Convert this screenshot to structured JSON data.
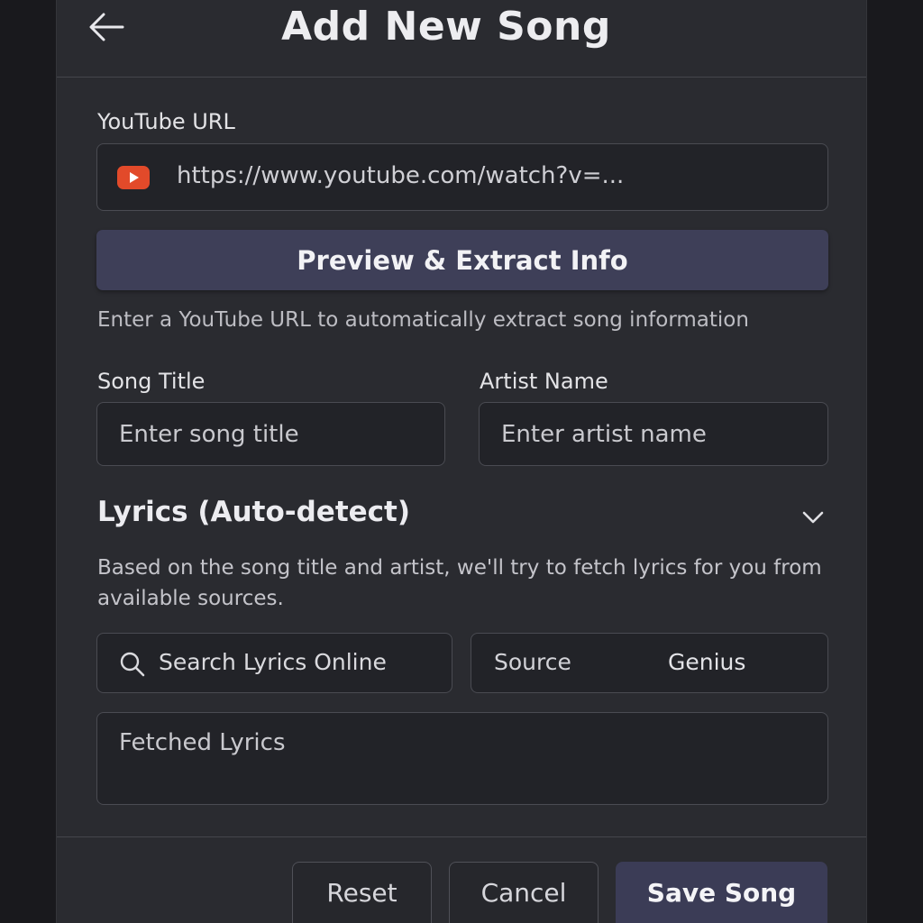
{
  "header": {
    "title": "Add New Song",
    "back_icon": "arrow-left-icon"
  },
  "youtube": {
    "label": "YouTube URL",
    "icon": "youtube-icon",
    "url_value": "https://www.youtube.com/watch?v=...",
    "extract_button_label": "Preview & Extract Info",
    "hint": "Enter a YouTube URL to automatically extract song information"
  },
  "song_title": {
    "label": "Song Title",
    "placeholder": "Enter song title"
  },
  "artist_name": {
    "label": "Artist Name",
    "placeholder": "Enter artist name"
  },
  "lyrics": {
    "section_title": "Lyrics (Auto-detect)",
    "toggle_icon": "chevron-down-icon",
    "description": "Based on the song title and artist, we'll try to fetch lyrics for you from available sources.",
    "search_button_label": "Search Lyrics Online",
    "search_icon": "search-icon",
    "source_label": "Source",
    "source_value": "Genius",
    "fetched_placeholder": "Fetched Lyrics"
  },
  "footer": {
    "reset_label": "Reset",
    "cancel_label": "Cancel",
    "save_label": "Save Song"
  },
  "colors": {
    "background": "#19191d",
    "panel": "#2a2b30",
    "field": "#222328",
    "primary_button": "#3e3f58",
    "youtube_red": "#e24a2a"
  }
}
